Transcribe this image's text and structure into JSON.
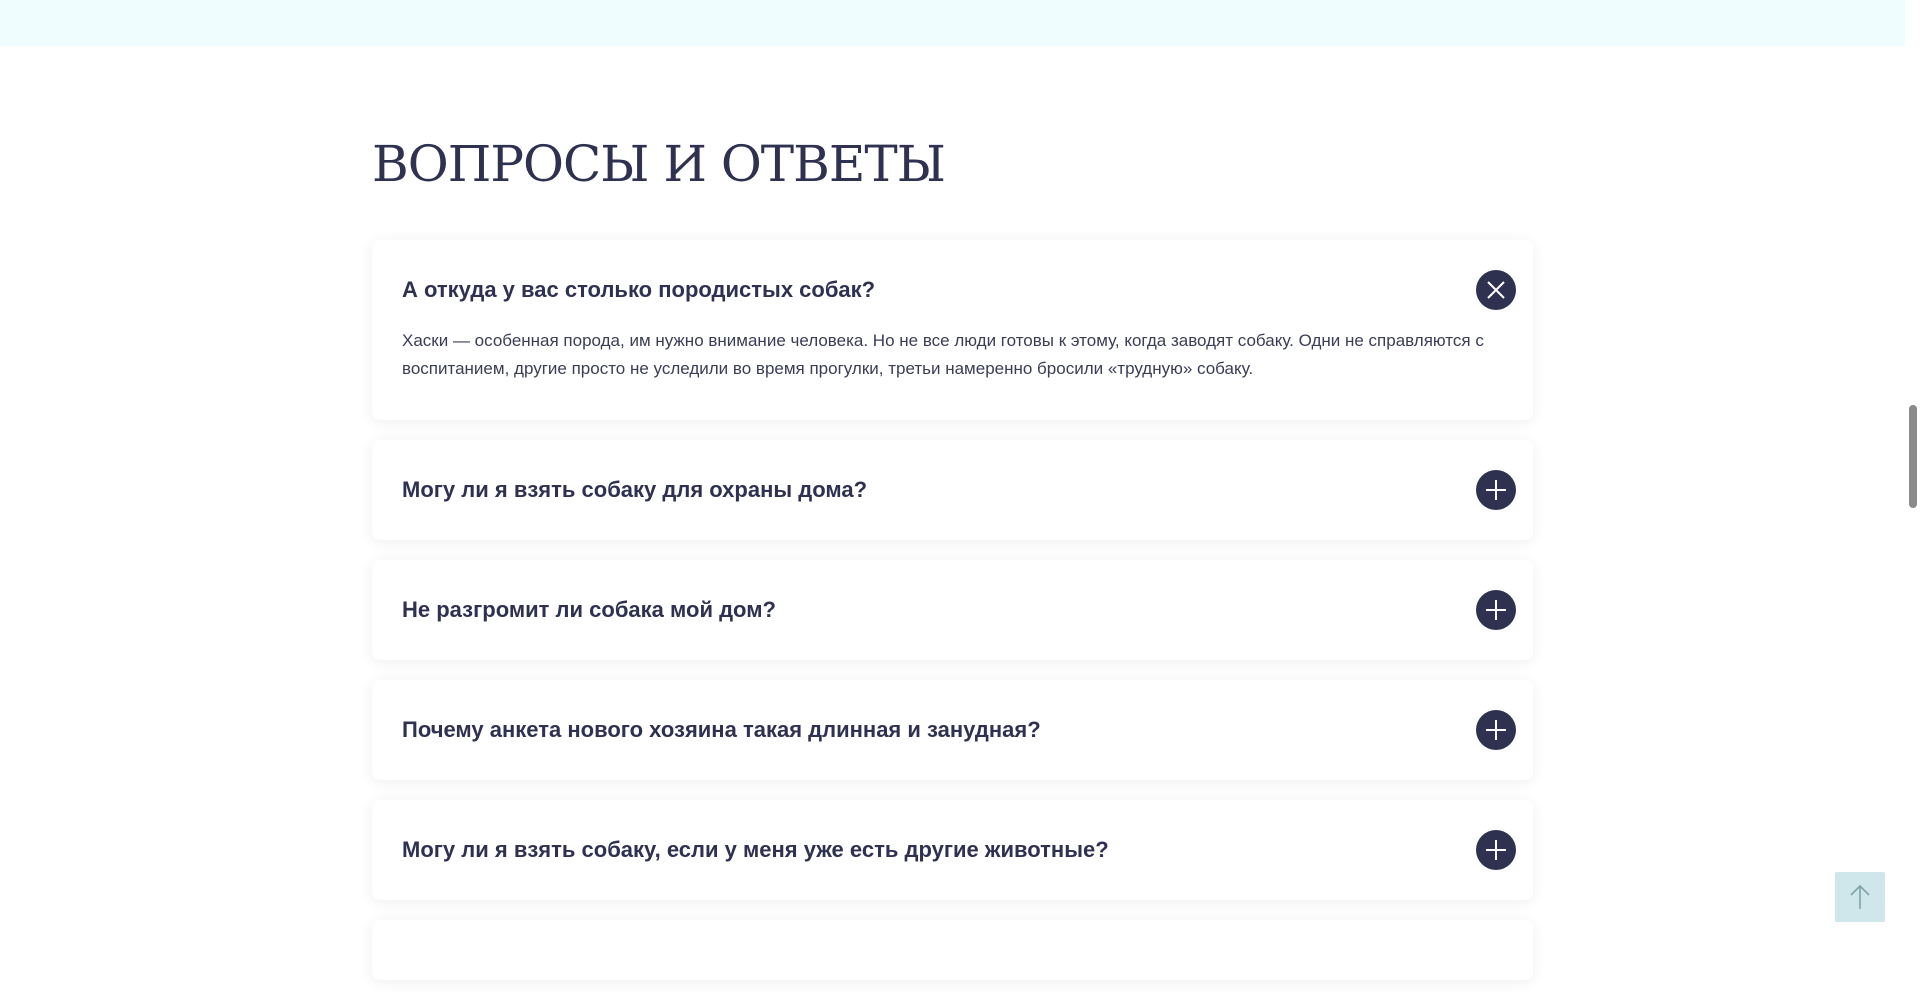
{
  "faq": {
    "title": "ВОПРОСЫ И ОТВЕТЫ",
    "items": [
      {
        "question": "А откуда у вас столько породистых собак?",
        "answer": "Хаски — особенная порода, им нужно внимание человека. Но не все люди готовы к этому, когда заводят собаку. Одни не справляются с воспитанием, другие просто не уследили во время прогулки, третьи намеренно бросили «трудную» собаку.",
        "expanded": true,
        "toggle_icon": "close-icon"
      },
      {
        "question": "Могу ли я взять собаку для охраны дома?",
        "expanded": false,
        "toggle_icon": "plus-icon"
      },
      {
        "question": "Не разгромит ли собака мой дом?",
        "expanded": false,
        "toggle_icon": "plus-icon"
      },
      {
        "question": "Почему анкета нового хозяина такая длинная и занудная?",
        "expanded": false,
        "toggle_icon": "plus-icon"
      },
      {
        "question": "Могу ли я взять собаку, если у меня уже есть другие животные?",
        "expanded": false,
        "toggle_icon": "plus-icon"
      }
    ]
  },
  "scroll_to_top": {
    "icon": "arrow-up-icon"
  },
  "colors": {
    "accent": "#2e3150",
    "top_band": "#effdfe",
    "to_top_bg": "#cfe6ea"
  }
}
